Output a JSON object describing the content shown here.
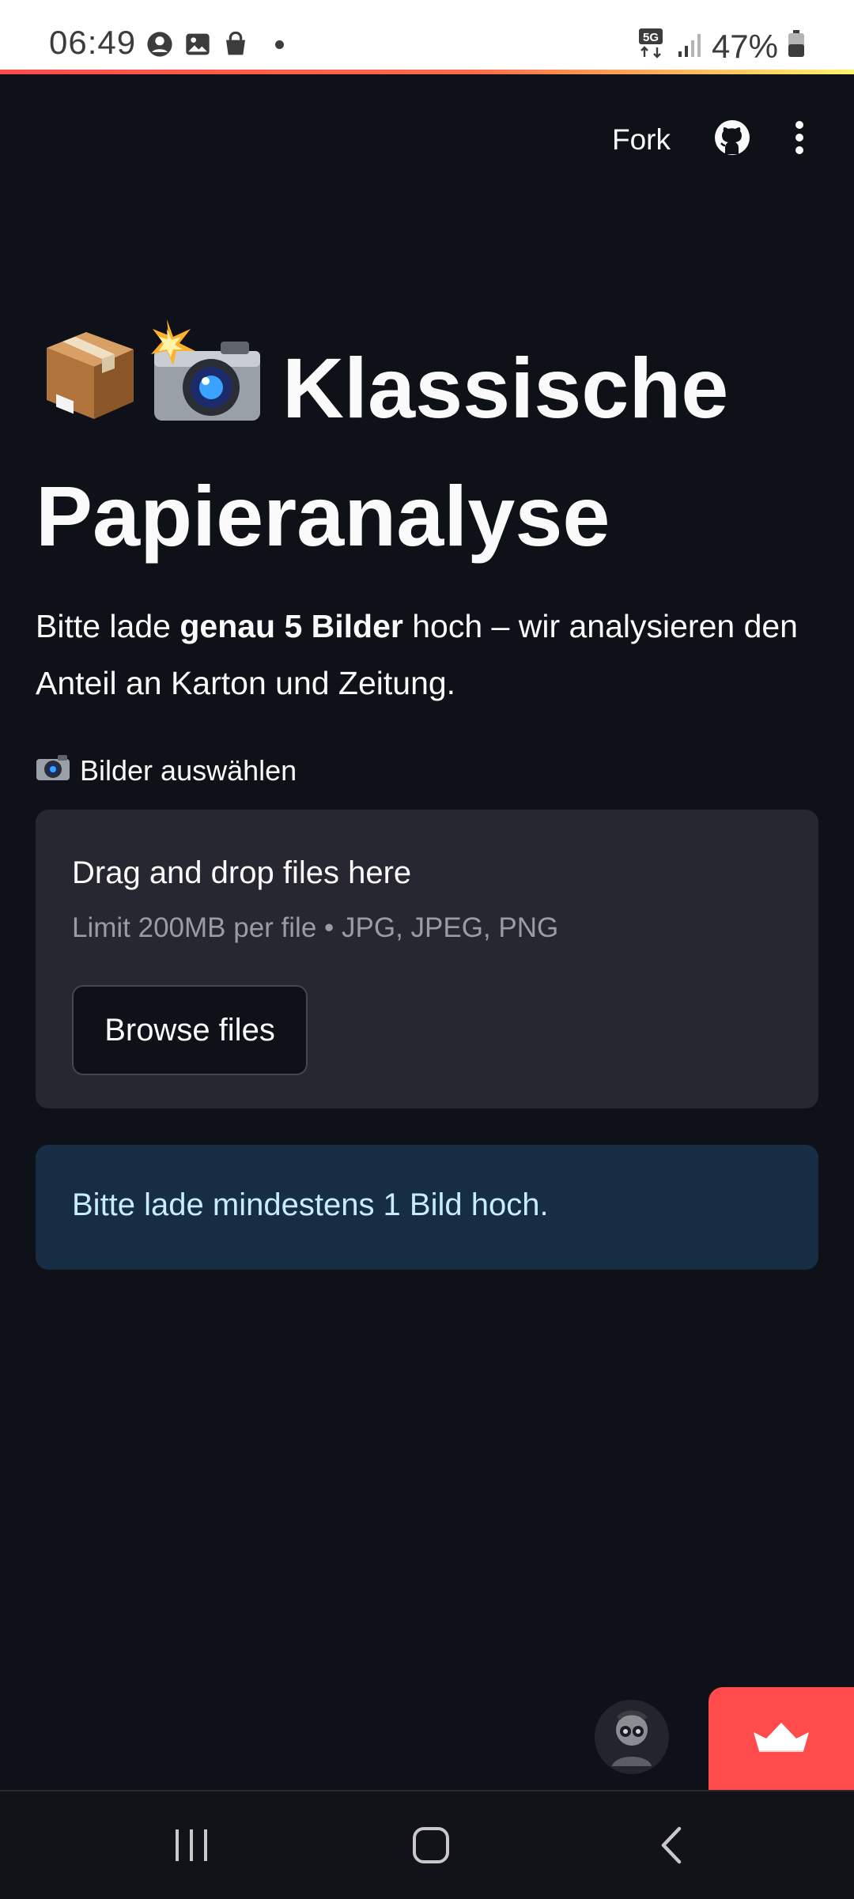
{
  "status_bar": {
    "time": "06:49",
    "battery": "47%",
    "network": "5G",
    "icons_left": [
      "account-circle-icon",
      "image-icon",
      "shopping-bag-icon",
      "notification-dot-icon"
    ],
    "icons_right": [
      "5g-icon",
      "signal-icon",
      "battery-icon"
    ]
  },
  "header": {
    "fork_label": "Fork",
    "github_icon": "github-icon",
    "menu_icon": "more-vertical-icon"
  },
  "title": {
    "emojis": [
      "📦",
      "📸"
    ],
    "text": "Klassische Papieranalyse"
  },
  "intro": {
    "before": "Bitte lade ",
    "bold": "genau 5 Bilder",
    "after": " hoch – wir analysieren den Anteil an Karton und Zeitung."
  },
  "uploader": {
    "label_icon": "camera-icon",
    "label": "Bilder auswählen",
    "drop_title": "Drag and drop files here",
    "limit_text": "Limit 200MB per file • JPG, JPEG, PNG",
    "browse_label": "Browse files"
  },
  "info_message": "Bitte lade mindestens 1 Bild hoch.",
  "footer": {
    "avatar": "user-avatar",
    "badge_icon": "streamlit-crown-icon"
  },
  "nav_bar": [
    "recent-apps-icon",
    "home-icon",
    "back-icon"
  ],
  "colors": {
    "background": "#0e1117",
    "card": "#262730",
    "info_bg": "#172d43",
    "info_text": "#c7ebff",
    "accent": "#ff4b4b"
  }
}
